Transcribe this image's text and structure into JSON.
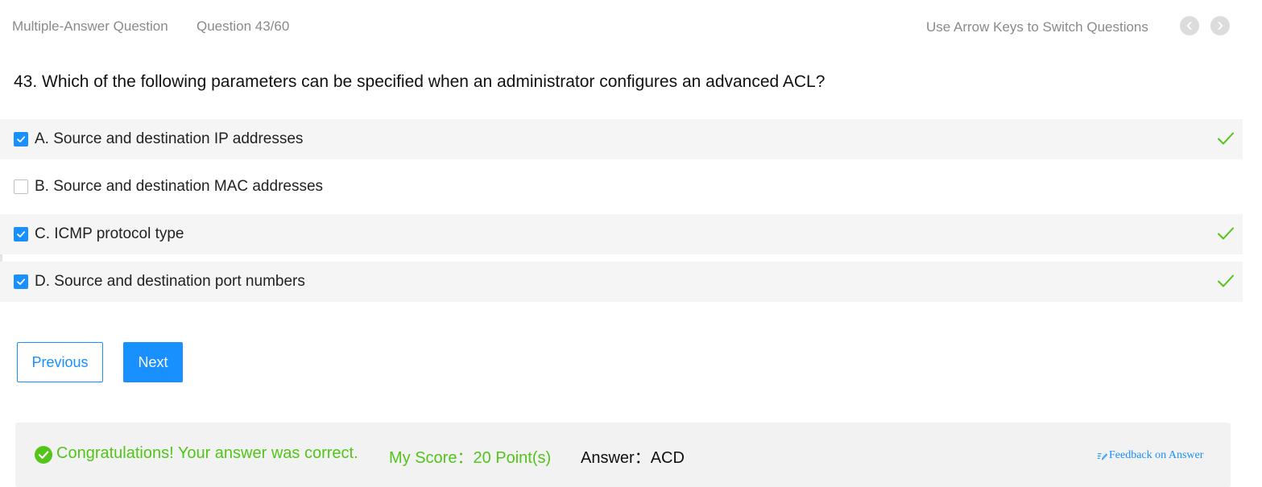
{
  "header": {
    "question_type": "Multiple-Answer Question",
    "question_counter": "Question 43/60",
    "nav_hint": "Use Arrow Keys to Switch Questions",
    "prev_icon": "chevron-left-icon",
    "next_icon": "chevron-right-icon"
  },
  "question": {
    "text": "43. Which of the following parameters can be specified when an administrator configures an advanced ACL?"
  },
  "options": [
    {
      "label": "A. Source and destination IP addresses",
      "checked": true,
      "correct": true
    },
    {
      "label": "B. Source and destination MAC addresses",
      "checked": false,
      "correct": false
    },
    {
      "label": "C. ICMP protocol type",
      "checked": true,
      "correct": true
    },
    {
      "label": "D. Source and destination port numbers",
      "checked": true,
      "correct": true
    }
  ],
  "buttons": {
    "previous": "Previous",
    "next": "Next"
  },
  "result": {
    "message": "Congratulations! Your answer was correct.",
    "score": "My Score：20 Point(s)",
    "answer": "Answer：ACD",
    "feedback_link": "Feedback on Answer"
  },
  "colors": {
    "accent": "#1890ff",
    "success": "#52c41a",
    "muted_text": "#8a8a8a",
    "option_shade": "#f5f5f5",
    "result_panel": "#f2f2f2"
  }
}
